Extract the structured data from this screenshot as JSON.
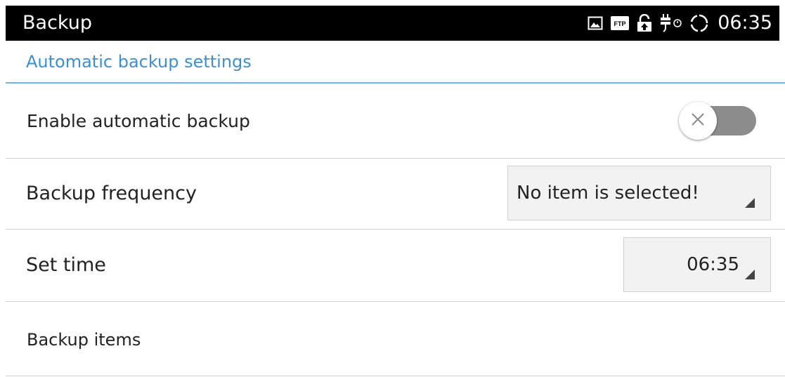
{
  "status_bar": {
    "title": "Backup",
    "time": "06:35",
    "icons": [
      "picture-icon",
      "ftp-icon",
      "lock-icon",
      "usb-icon",
      "sync-icon"
    ],
    "ftp_text": "FTP"
  },
  "section": {
    "title": "Automatic backup settings",
    "accent_color": "#3d8fd0"
  },
  "settings": {
    "enable_backup": {
      "label": "Enable automatic backup",
      "enabled": false
    },
    "frequency": {
      "label": "Backup frequency",
      "value": "No item is selected!"
    },
    "set_time": {
      "label": "Set time",
      "value": "06:35"
    },
    "backup_items": {
      "label": "Backup items"
    }
  }
}
